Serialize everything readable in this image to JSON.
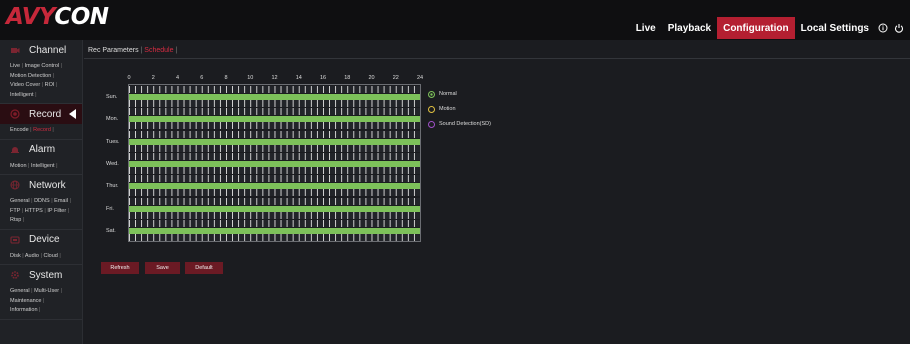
{
  "app": {
    "logo_prefix": "AVY",
    "logo_suffix": "CON"
  },
  "nav": {
    "items": [
      {
        "label": "Live",
        "active": false
      },
      {
        "label": "Playback",
        "active": false
      },
      {
        "label": "Configuration",
        "active": true
      },
      {
        "label": "Local Settings",
        "active": false
      }
    ],
    "icons": [
      "info-icon",
      "power-icon"
    ]
  },
  "sidebar": {
    "sections": [
      {
        "label": "Channel",
        "icon": "camera-icon",
        "active": false,
        "subs": [
          [
            "Live",
            "Image Control"
          ],
          [
            "Motion Detection"
          ],
          [
            "Video Cover",
            "ROI"
          ],
          [
            "Intelligent"
          ]
        ]
      },
      {
        "label": "Record",
        "icon": "record-icon",
        "active": true,
        "subs": [
          [
            "Encode",
            "Record"
          ]
        ],
        "selected_sub": "Record"
      },
      {
        "label": "Alarm",
        "icon": "alarm-icon",
        "active": false,
        "subs": [
          [
            "Motion",
            "Intelligent"
          ]
        ]
      },
      {
        "label": "Network",
        "icon": "network-icon",
        "active": false,
        "subs": [
          [
            "General",
            "DDNS",
            "Email"
          ],
          [
            "FTP",
            "HTTPS",
            "IP Filter"
          ],
          [
            "Rtsp"
          ]
        ]
      },
      {
        "label": "Device",
        "icon": "device-icon",
        "active": false,
        "subs": [
          [
            "Disk",
            "Audio",
            "Cloud"
          ]
        ]
      },
      {
        "label": "System",
        "icon": "system-icon",
        "active": false,
        "subs": [
          [
            "General",
            "Multi-User"
          ],
          [
            "Maintenance"
          ],
          [
            "Information"
          ]
        ]
      }
    ]
  },
  "tabs": {
    "first": "Rec Parameters",
    "second": "Schedule"
  },
  "schedule": {
    "hour_labels": [
      "0",
      "2",
      "4",
      "6",
      "8",
      "10",
      "12",
      "14",
      "16",
      "18",
      "20",
      "22",
      "24"
    ],
    "days": [
      "Sun.",
      "Mon.",
      "Tues.",
      "Wed.",
      "Thur.",
      "Fri.",
      "Sat."
    ],
    "mode_per_day": [
      "Normal",
      "Normal",
      "Normal",
      "Normal",
      "Normal",
      "Normal",
      "Normal"
    ]
  },
  "legend": [
    {
      "label": "Normal",
      "color": "#7dc15a"
    },
    {
      "label": "Motion",
      "color": "#e0c040"
    },
    {
      "label": "Sound Detection(SD)",
      "color": "#a050c8"
    }
  ],
  "buttons": {
    "refresh": "Refresh",
    "save": "Save",
    "default": "Default"
  },
  "colors": {
    "accent": "#b41f31",
    "normal": "#7dc15a"
  }
}
